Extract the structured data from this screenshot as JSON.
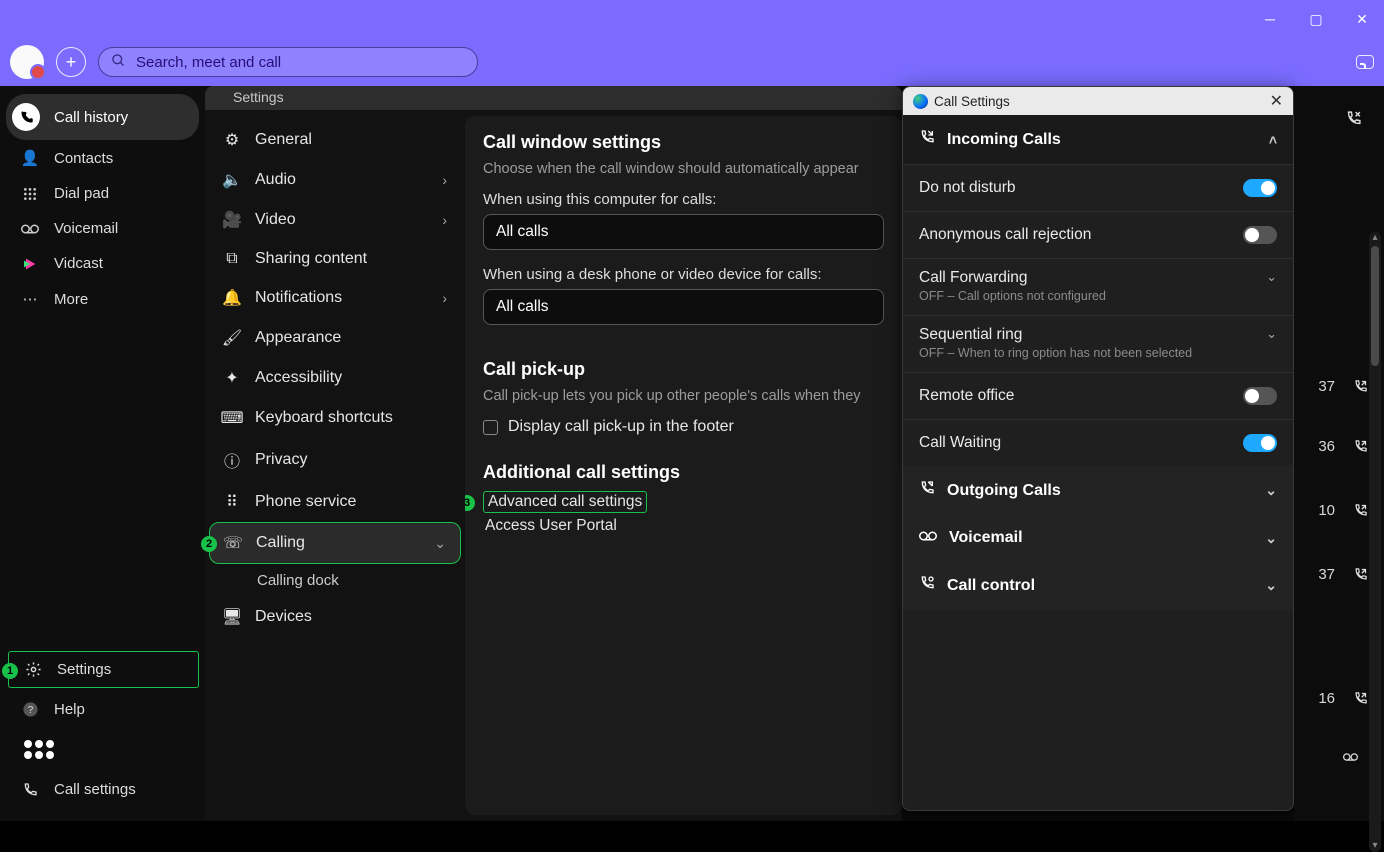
{
  "search": {
    "placeholder": "Search, meet and call"
  },
  "nav": {
    "call_history": "Call history",
    "contacts": "Contacts",
    "dial_pad": "Dial pad",
    "voicemail": "Voicemail",
    "vidcast": "Vidcast",
    "more": "More",
    "settings": "Settings",
    "help": "Help",
    "call_settings": "Call settings"
  },
  "step_badges": {
    "settings": "1",
    "calling": "2",
    "advanced": "3"
  },
  "settings_tab": "Settings",
  "settings_cats": {
    "general": "General",
    "audio": "Audio",
    "video": "Video",
    "sharing": "Sharing content",
    "notifications": "Notifications",
    "appearance": "Appearance",
    "accessibility": "Accessibility",
    "keyboard": "Keyboard shortcuts",
    "privacy": "Privacy",
    "phone_service": "Phone service",
    "calling": "Calling",
    "calling_dock": "Calling dock",
    "devices": "Devices"
  },
  "call_window": {
    "heading": "Call window settings",
    "desc": "Choose when the call window should automatically appear",
    "label_computer": "When using this computer for calls:",
    "value_computer": "All calls",
    "label_desk": "When using a desk phone or video device for calls:",
    "value_desk": "All calls"
  },
  "pickup": {
    "heading": "Call pick-up",
    "desc": "Call pick-up lets you pick up other people's calls when they",
    "checkbox": "Display call pick-up in the footer"
  },
  "additional": {
    "heading": "Additional call settings",
    "advanced": "Advanced call settings",
    "portal": "Access User Portal"
  },
  "popup": {
    "title": "Call Settings",
    "incoming": "Incoming Calls",
    "dnd": "Do not disturb",
    "anon": "Anonymous call rejection",
    "fwd_t": "Call Forwarding",
    "fwd_s": "OFF – Call options not configured",
    "seq_t": "Sequential ring",
    "seq_s": "OFF – When to ring option has not been selected",
    "remote": "Remote office",
    "waiting": "Call Waiting",
    "outgoing": "Outgoing Calls",
    "voicemail": "Voicemail",
    "control": "Call control"
  },
  "rightstrip": {
    "items": [
      {
        "n": "37"
      },
      {
        "n": "36"
      },
      {
        "n": "10"
      },
      {
        "n": "37"
      },
      {
        "n": "16"
      }
    ]
  }
}
